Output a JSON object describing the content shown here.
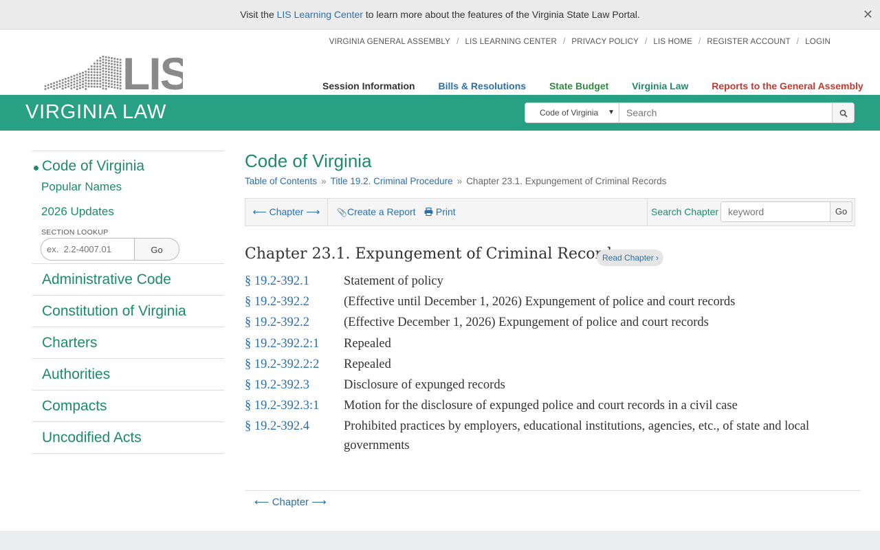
{
  "notice": {
    "prefix": "Visit the",
    "link": "LIS Learning Center",
    "suffix": "to learn more about the features of the Virginia State Law Portal.",
    "close": "✕"
  },
  "logo_text": "LIS",
  "top_nav": [
    "VIRGINIA GENERAL ASSEMBLY",
    "LIS LEARNING CENTER",
    "PRIVACY POLICY",
    "LIS HOME",
    "REGISTER ACCOUNT",
    "LOGIN"
  ],
  "main_nav": [
    "Session Information",
    "Bills & Resolutions",
    "State Budget",
    "Virginia Law",
    "Reports to the General Assembly"
  ],
  "banner": {
    "title": "VIRGINIA LAW",
    "select_value": "Code of Virginia",
    "search_placeholder": "Search"
  },
  "sidebar": {
    "current": "Code of Virginia",
    "sub_items": [
      "Popular Names",
      "2026 Updates"
    ],
    "lookup_label": "SECTION LOOKUP",
    "lookup_placeholder": "ex.  2.2-4007.01",
    "lookup_go": "Go",
    "items": [
      "Administrative Code",
      "Constitution of Virginia",
      "Charters",
      "Authorities",
      "Compacts",
      "Uncodified Acts"
    ]
  },
  "main": {
    "title": "Code of Virginia",
    "breadcrumb": [
      "Table of Contents",
      "Title 19.2. Criminal Procedure",
      "Chapter 23.1. Expungement of Criminal Records"
    ],
    "breadcrumb_sep": "»",
    "toolbar": {
      "chapter": "Chapter",
      "create_report": "Create a Report",
      "print": "Print",
      "search_label": "Search Chapter",
      "search_placeholder": "keyword",
      "go": "Go"
    },
    "chapter_heading": "Chapter 23.1. Expungement of Criminal Records",
    "read_chapter": "Read Chapter",
    "sections": [
      {
        "num": "§ 19.2-392.1",
        "title": "Statement of policy"
      },
      {
        "num": "§ 19.2-392.2",
        "title": "(Effective until December 1, 2026) Expungement of police and court records"
      },
      {
        "num": "§ 19.2-392.2",
        "title": "(Effective December 1, 2026) Expungement of police and court records"
      },
      {
        "num": "§ 19.2-392.2:1",
        "title": "Repealed"
      },
      {
        "num": "§ 19.2-392.2:2",
        "title": "Repealed"
      },
      {
        "num": "§ 19.2-392.3",
        "title": "Disclosure of expunged records"
      },
      {
        "num": "§ 19.2-392.3:1",
        "title": "Motion for the disclosure of expunged police and court records in a civil case"
      },
      {
        "num": "§ 19.2-392.4",
        "title": "Prohibited practices by employers, educational institutions, agencies, etc., of state and local governments"
      }
    ],
    "bottom_chapter": "Chapter"
  },
  "colors": {
    "brand_green": "#27a083",
    "link_blue": "#2a6fb0",
    "nav_green": "#1e8a6c",
    "reports_red": "#c8372a"
  },
  "icons": [
    "close-icon",
    "search-icon",
    "arrow-left-icon",
    "arrow-right-icon",
    "paperclip-icon",
    "print-icon",
    "chevron-right-icon"
  ]
}
